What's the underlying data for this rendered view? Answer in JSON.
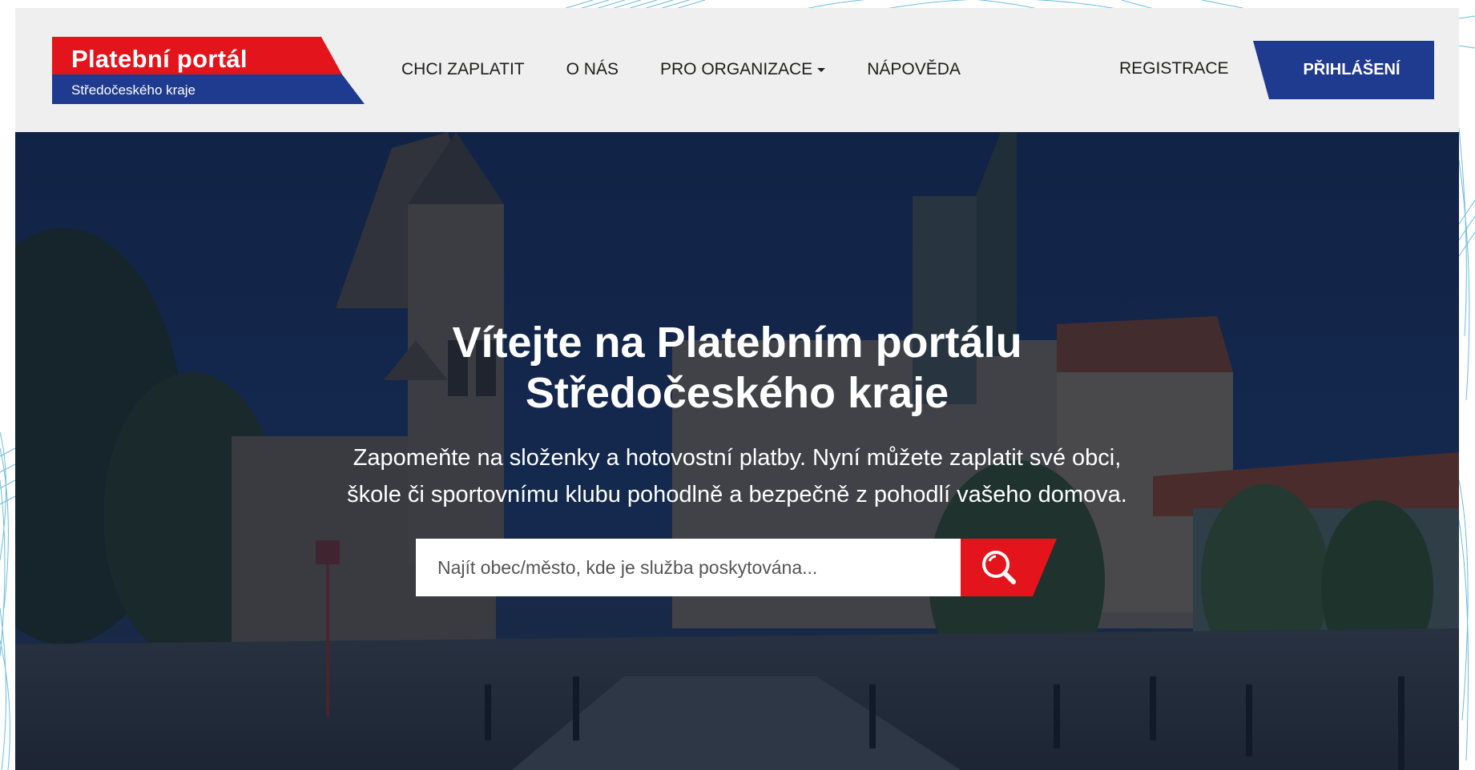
{
  "brand": {
    "title": "Platební portál",
    "subtitle": "Středočeského kraje",
    "red": "#e3141b",
    "blue": "#1f3b8f"
  },
  "nav": {
    "items": [
      {
        "label": "CHCI ZAPLATIT"
      },
      {
        "label": "O NÁS"
      },
      {
        "label": "PRO ORGANIZACE",
        "has_dropdown": true
      },
      {
        "label": "NÁPOVĚDA"
      }
    ],
    "register_label": "REGISTRACE",
    "login_label": "PŘIHLÁŠENÍ"
  },
  "hero": {
    "title_line1": "Vítejte na Platebním portálu",
    "title_line2": "Středočeského kraje",
    "subtitle_line1": "Zapomeňte na složenky a hotovostní platby. Nyní můžete zaplatit své obci,",
    "subtitle_line2": "škole či sportovnímu klubu pohodlně a bezpečně z pohodlí vašeho domova.",
    "search_placeholder": "Najít obec/město, kde je služba poskytována...",
    "search_icon": "search-icon"
  },
  "colors": {
    "header_bg": "#efefef",
    "hero_overlay": "#0d1d3a",
    "accent_red": "#e3141b",
    "accent_blue": "#1f3b8f"
  }
}
